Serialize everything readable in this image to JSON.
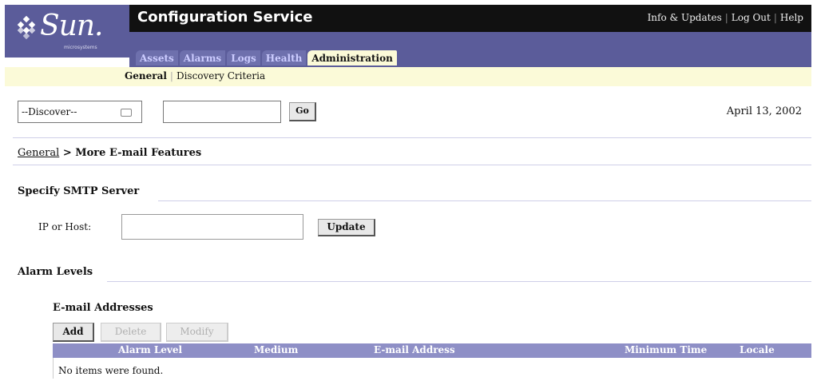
{
  "brand": {
    "logo_text": "Sun.",
    "logo_sub": "microsystems"
  },
  "header": {
    "title": "Configuration Service",
    "links": [
      "Info & Updates",
      "Log Out",
      "Help"
    ]
  },
  "tabs": [
    {
      "label": "Assets",
      "active": false
    },
    {
      "label": "Alarms",
      "active": false
    },
    {
      "label": "Logs",
      "active": false
    },
    {
      "label": "Health",
      "active": false
    },
    {
      "label": "Administration",
      "active": true
    }
  ],
  "subnav": {
    "items": [
      "General",
      "Discovery Criteria"
    ],
    "active": "General"
  },
  "toolbar": {
    "discover_select": "--Discover--",
    "search_value": "",
    "go_label": "Go",
    "date": "April 13, 2002"
  },
  "breadcrumb": {
    "link": "General",
    "separator": ">",
    "current": "More E-mail Features"
  },
  "smtp": {
    "section_title": "Specify SMTP Server",
    "field_label": "IP or Host:",
    "field_value": "",
    "update_label": "Update"
  },
  "alarm": {
    "section_title": "Alarm Levels",
    "email_title": "E-mail Addresses",
    "buttons": {
      "add": "Add",
      "delete": "Delete",
      "modify": "Modify"
    },
    "columns": [
      "Alarm Level",
      "Medium",
      "E-mail Address",
      "Minimum Time",
      "Locale"
    ],
    "empty_text": "No items were found."
  },
  "colors": {
    "brand_purple": "#5b5c9a",
    "table_header": "#8e8fc6",
    "subnav_bg": "#fbfad8",
    "title_bar": "#111111"
  }
}
